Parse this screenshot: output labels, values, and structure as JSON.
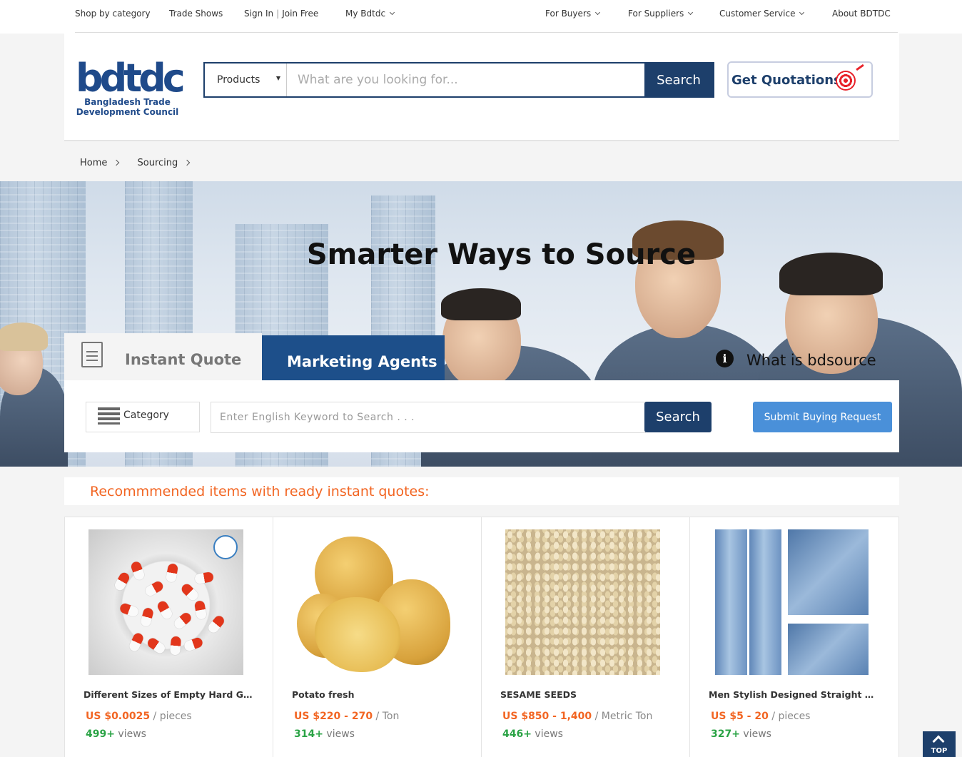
{
  "topbar": {
    "shop_by_category": "Shop by category",
    "trade_shows": "Trade Shows",
    "sign_in": "Sign In",
    "separator": "|",
    "join_free": "Join Free",
    "my_bdtdc": "My Bdtdc",
    "for_buyers": "For Buyers",
    "for_suppliers": "For Suppliers",
    "customer_service": "Customer Service",
    "about": "About BDTDC"
  },
  "logo": {
    "mark": "bdtdc",
    "line1": "Bangladesh Trade",
    "line2": "Development Council"
  },
  "search": {
    "category": "Products",
    "placeholder": "What are you looking for...",
    "button": "Search"
  },
  "get_quotations": "Get Quotations",
  "breadcrumb": [
    "Home",
    "Sourcing"
  ],
  "hero": {
    "title": "Smarter Ways to Source",
    "tab_instant": "Instant Quote",
    "tab_agents": "Marketing Agents",
    "what_is": "What is bdsource",
    "category_label": "Category",
    "keyword_placeholder": "Enter English Keyword to Search . . .",
    "search_button": "Search",
    "submit_button": "Submit Buying Request"
  },
  "recommended_title": "Recommmended items with ready instant quotes:",
  "products": [
    {
      "name": "Different Sizes of Empty Hard Gel...",
      "price": "US $0.0025",
      "unit": "pieces",
      "views_num": "499+",
      "views_label": "views",
      "image": "capsules"
    },
    {
      "name": "Potato fresh",
      "price": "US $220 - 270",
      "unit": "Ton",
      "views_num": "314+",
      "views_label": "views",
      "image": "potatoes"
    },
    {
      "name": "SESAME SEEDS",
      "price": "US $850 - 1,400",
      "unit": "Metric Ton",
      "views_num": "446+",
      "views_label": "views",
      "image": "sesame-seeds"
    },
    {
      "name": "Men Stylish Designed Straight Sli...",
      "price": "US $5 - 20",
      "unit": "pieces",
      "views_num": "327+",
      "views_label": "views",
      "image": "jeans"
    }
  ],
  "price_separator": "/",
  "top_button": "TOP",
  "colors": {
    "navy": "#1d3f6b",
    "agents_tab": "#1d4f8a",
    "submit_blue": "#4a90d9",
    "price_orange": "#f26522",
    "views_green": "#2aa345"
  }
}
